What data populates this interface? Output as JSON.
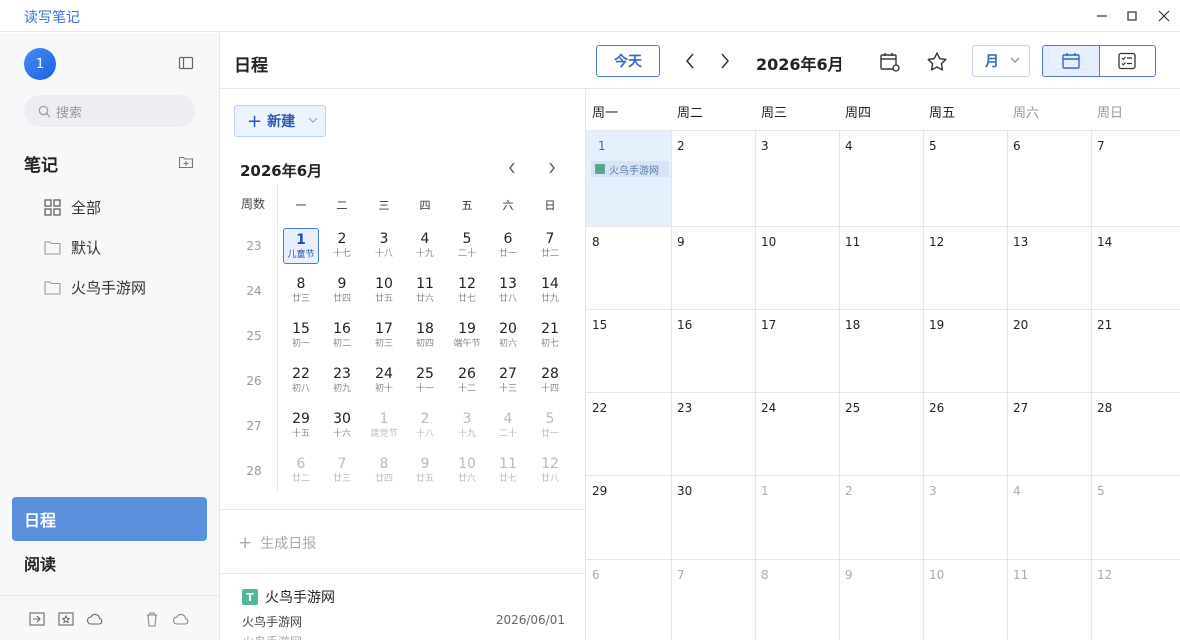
{
  "app": {
    "title": "读写笔记"
  },
  "window": {
    "minimize": "—",
    "maximize": "☐",
    "close": "✕"
  },
  "sidebar": {
    "avatar_text": "1",
    "search_placeholder": "搜索",
    "notes_title": "笔记",
    "items": [
      {
        "label": "全部",
        "icon": "grid-icon"
      },
      {
        "label": "默认",
        "icon": "folder-icon"
      },
      {
        "label": "火鸟手游网",
        "icon": "folder-icon"
      }
    ],
    "schedule_label": "日程",
    "reading_label": "阅读"
  },
  "header": {
    "title": "日程",
    "today_label": "今天",
    "month_label": "2026年6月",
    "view_mode": "月"
  },
  "middle": {
    "new_label": "新建",
    "mini_month": "2026年6月",
    "week_col_label": "周数",
    "weekdays": [
      "一",
      "二",
      "三",
      "四",
      "五",
      "六",
      "日"
    ],
    "weeks": [
      {
        "num": "23",
        "days": [
          {
            "d": "1",
            "l": "儿童节",
            "sel": true
          },
          {
            "d": "2",
            "l": "十七"
          },
          {
            "d": "3",
            "l": "十八"
          },
          {
            "d": "4",
            "l": "十九"
          },
          {
            "d": "5",
            "l": "二十"
          },
          {
            "d": "6",
            "l": "廿一"
          },
          {
            "d": "7",
            "l": "廿二"
          }
        ]
      },
      {
        "num": "24",
        "days": [
          {
            "d": "8",
            "l": "廿三"
          },
          {
            "d": "9",
            "l": "廿四"
          },
          {
            "d": "10",
            "l": "廿五"
          },
          {
            "d": "11",
            "l": "廿六"
          },
          {
            "d": "12",
            "l": "廿七"
          },
          {
            "d": "13",
            "l": "廿八"
          },
          {
            "d": "14",
            "l": "廿九"
          }
        ]
      },
      {
        "num": "25",
        "days": [
          {
            "d": "15",
            "l": "初一"
          },
          {
            "d": "16",
            "l": "初二"
          },
          {
            "d": "17",
            "l": "初三"
          },
          {
            "d": "18",
            "l": "初四"
          },
          {
            "d": "19",
            "l": "端午节"
          },
          {
            "d": "20",
            "l": "初六"
          },
          {
            "d": "21",
            "l": "初七"
          }
        ]
      },
      {
        "num": "26",
        "days": [
          {
            "d": "22",
            "l": "初八"
          },
          {
            "d": "23",
            "l": "初九"
          },
          {
            "d": "24",
            "l": "初十"
          },
          {
            "d": "25",
            "l": "十一"
          },
          {
            "d": "26",
            "l": "十二"
          },
          {
            "d": "27",
            "l": "十三"
          },
          {
            "d": "28",
            "l": "十四"
          }
        ]
      },
      {
        "num": "27",
        "days": [
          {
            "d": "29",
            "l": "十五"
          },
          {
            "d": "30",
            "l": "十六"
          },
          {
            "d": "1",
            "l": "建党节",
            "other": true
          },
          {
            "d": "2",
            "l": "十八",
            "other": true
          },
          {
            "d": "3",
            "l": "十九",
            "other": true
          },
          {
            "d": "4",
            "l": "二十",
            "other": true
          },
          {
            "d": "5",
            "l": "廿一",
            "other": true
          }
        ]
      },
      {
        "num": "28",
        "days": [
          {
            "d": "6",
            "l": "廿二",
            "other": true
          },
          {
            "d": "7",
            "l": "廿三",
            "other": true
          },
          {
            "d": "8",
            "l": "廿四",
            "other": true
          },
          {
            "d": "9",
            "l": "廿五",
            "other": true
          },
          {
            "d": "10",
            "l": "廿六",
            "other": true
          },
          {
            "d": "11",
            "l": "廿七",
            "other": true
          },
          {
            "d": "12",
            "l": "廿八",
            "other": true
          }
        ]
      }
    ],
    "gen_report_label": "生成日报",
    "note_card": {
      "title": "火鸟手游网",
      "subtitle": "火鸟手游网",
      "date": "2026/06/01",
      "folder": "火鸟手游网"
    }
  },
  "calendar": {
    "headers": [
      "周一",
      "周二",
      "周三",
      "周四",
      "周五",
      "周六",
      "周日"
    ],
    "event_label": "火鸟手游网",
    "rows": [
      [
        "1",
        "2",
        "3",
        "4",
        "5",
        "6",
        "7"
      ],
      [
        "8",
        "9",
        "10",
        "11",
        "12",
        "13",
        "14"
      ],
      [
        "15",
        "16",
        "17",
        "18",
        "19",
        "20",
        "21"
      ],
      [
        "22",
        "23",
        "24",
        "25",
        "26",
        "27",
        "28"
      ],
      [
        "29",
        "30",
        "1",
        "2",
        "3",
        "4",
        "5"
      ],
      [
        "6",
        "7",
        "8",
        "9",
        "10",
        "11",
        "12"
      ]
    ],
    "other_month_from": [
      [],
      [],
      [],
      [],
      [
        2,
        3,
        4,
        5,
        6
      ],
      [
        0,
        1,
        2,
        3,
        4,
        5,
        6
      ]
    ]
  },
  "colors": {
    "accent": "#3566c8",
    "active_nav": "#5b8fdc",
    "today_bg": "#e5f0fd"
  }
}
